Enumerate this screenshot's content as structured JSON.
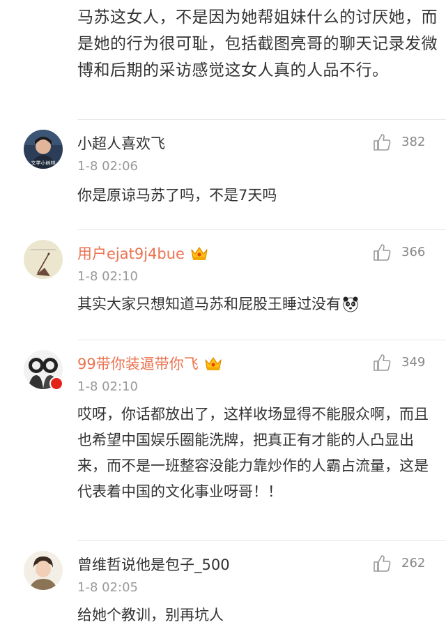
{
  "top_comment": {
    "text": "马苏这女人，不是因为她帮姐妹什么的讨厌她，而是她的行为很可耻，包括截图亮哥的聊天记录发微博和后期的采访感觉这女人真的人品不行。"
  },
  "comments": [
    {
      "username": "小超人喜欢飞",
      "time": "1-8 02:06",
      "likes": "382",
      "text": "你是原谅马苏了吗，不是7天吗",
      "vip": false,
      "avatar_caption": "文学小树林"
    },
    {
      "username": "用户ejat9j4bue",
      "time": "1-8 02:10",
      "likes": "366",
      "text": "其实大家只想知道马苏和屁股王睡过没有",
      "vip": true
    },
    {
      "username": "99带你装逼带你飞",
      "time": "1-8 02:10",
      "likes": "349",
      "text": "哎呀，你话都放出了，这样收场显得不能服众啊，而且也希望中国娱乐圈能洗牌，把真正有才能的人凸显出来，而不是一班整容没能力靠炒作的人霸占流量，这是代表着中国的文化事业呀哥！！",
      "vip": true
    },
    {
      "username": "曾维哲说他是包子_500",
      "time": "1-8 02:05",
      "likes": "262",
      "text": "给她个教训，别再坑人",
      "vip": false
    }
  ],
  "colors": {
    "vip_name": "#eb7350",
    "text": "#333333",
    "meta": "#999999",
    "divider": "#e6e6e6"
  },
  "icons": [
    "thumbs-up-icon",
    "vip-crown-icon",
    "panda-emoji-icon"
  ]
}
